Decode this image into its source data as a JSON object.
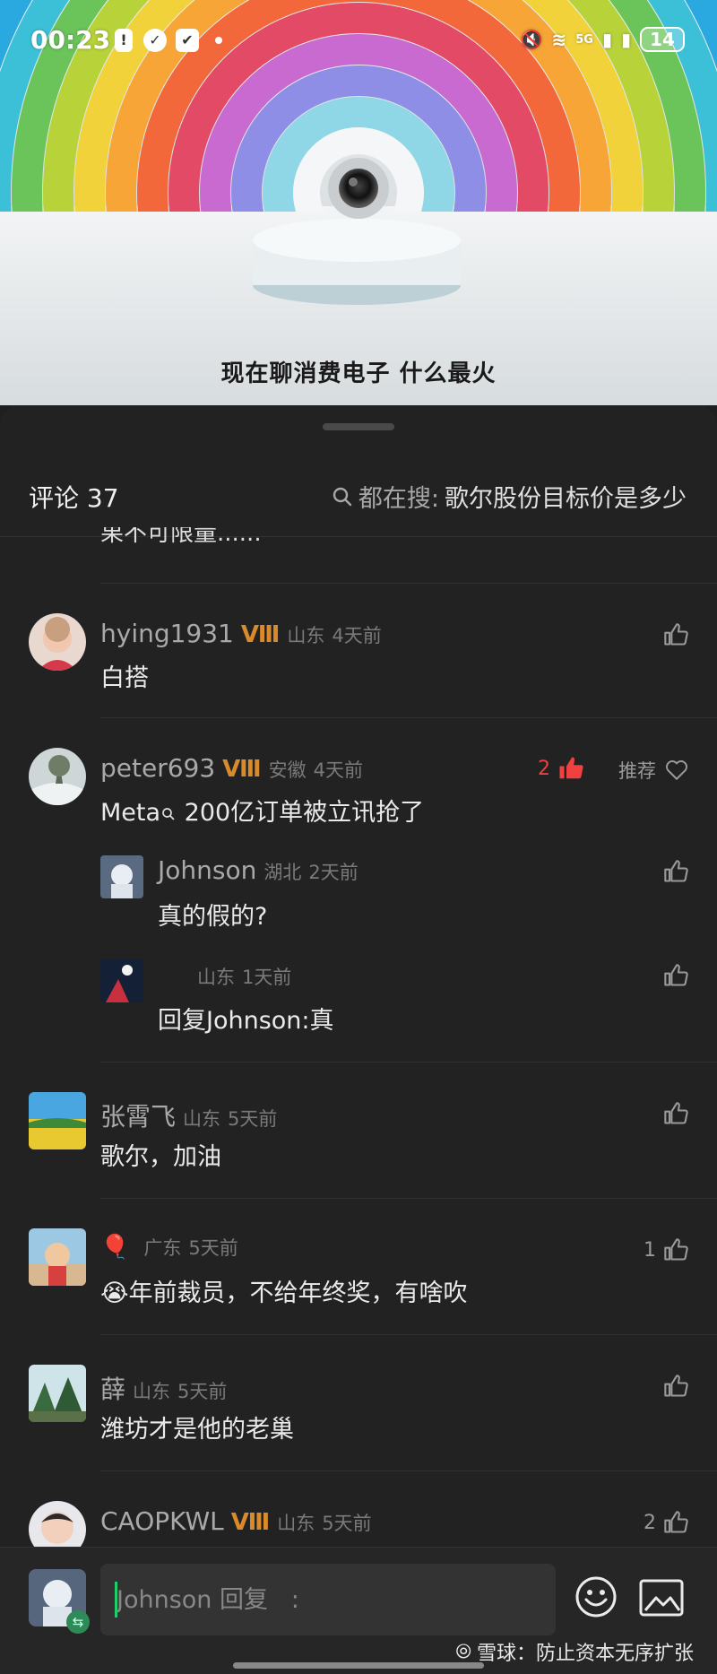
{
  "status_bar": {
    "time": "00:23",
    "network": "5G",
    "battery": "14"
  },
  "video": {
    "subtitle": "现在聊消费电子 什么最火"
  },
  "sheet": {
    "comment_count": "评论 37",
    "hot_search_prefix": "都在搜:",
    "hot_search_query": "歌尔股份目标价是多少",
    "clipped_previous": "果不可限量......"
  },
  "comments": [
    {
      "username": "hying1931",
      "vip": "Ⅷ",
      "location": "山东",
      "time": "4天前",
      "text": "白搭",
      "likes": ""
    },
    {
      "username": "peter693",
      "vip": "Ⅷ",
      "location": "安徽",
      "time": "4天前",
      "text_prefix": "Meta",
      "text": "200亿订单被立讯抢了",
      "likes": "2",
      "recommend": "推荐",
      "replies": [
        {
          "username": "Johnson",
          "location": "湖北",
          "time": "2天前",
          "text": "真的假的?"
        },
        {
          "username": "",
          "location": "山东",
          "time": "1天前",
          "text": "回复Johnson:真"
        }
      ]
    },
    {
      "username": "张霄飞",
      "location": "山东",
      "time": "5天前",
      "text": "歌尔，加油",
      "likes": ""
    },
    {
      "username": "",
      "location": "广东",
      "time": "5天前",
      "text": "😭年前裁员，不给年终奖，有啥吹",
      "likes": "1"
    },
    {
      "username": "薛",
      "location": "山东",
      "time": "5天前",
      "text": "潍坊才是他的老巢",
      "likes": ""
    },
    {
      "username": "CAOPKWL",
      "vip": "Ⅷ",
      "location": "山东",
      "time": "5天前",
      "text": "",
      "likes": "2"
    }
  ],
  "input_bar": {
    "placeholder": "Johnson 回复   :",
    "watermark": "雪球：防止资本无序扩张"
  },
  "colors": {
    "sheet_bg": "#222222",
    "like_active": "#f04040",
    "vip_badge": "#d98a2b",
    "caret": "#1fcf6a"
  }
}
